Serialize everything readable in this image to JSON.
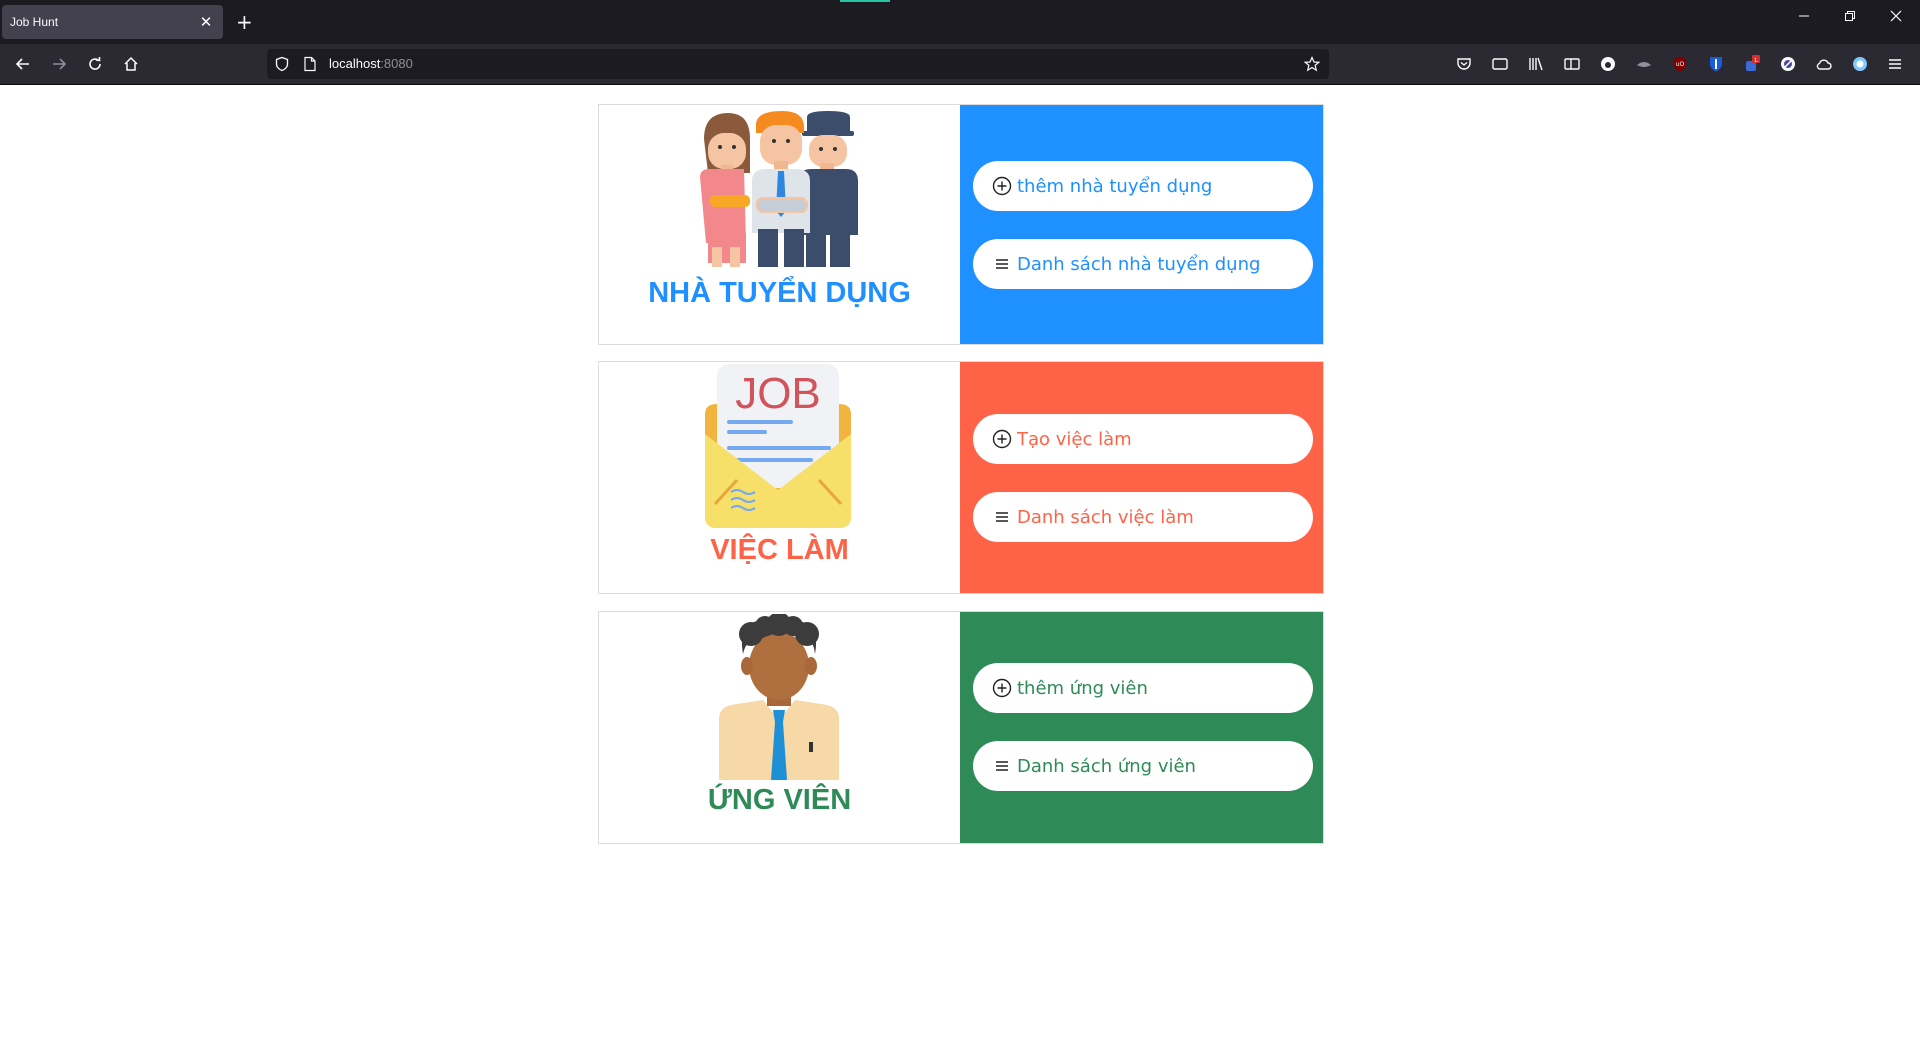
{
  "browser": {
    "tab_title": "Job Hunt",
    "url_host": "localhost",
    "url_port": ":8080"
  },
  "cards": [
    {
      "title": "NHÀ TUYỂN DỤNG",
      "color": "#1e90ff",
      "illustration": "recruiters-people-icon",
      "add_label": "thêm nhà tuyển dụng",
      "list_label": "Danh sách nhà tuyển dụng"
    },
    {
      "title": "VIỆC LÀM",
      "color": "#ff6347",
      "illustration": "job-envelope-icon",
      "illustration_text": "JOB",
      "add_label": "Tạo việc làm",
      "list_label": "Danh sách việc làm"
    },
    {
      "title": "ỨNG VIÊN",
      "color": "#2e8b57",
      "illustration": "candidate-person-icon",
      "add_label": "thêm ứng viên",
      "list_label": "Danh sách ứng viên"
    }
  ]
}
